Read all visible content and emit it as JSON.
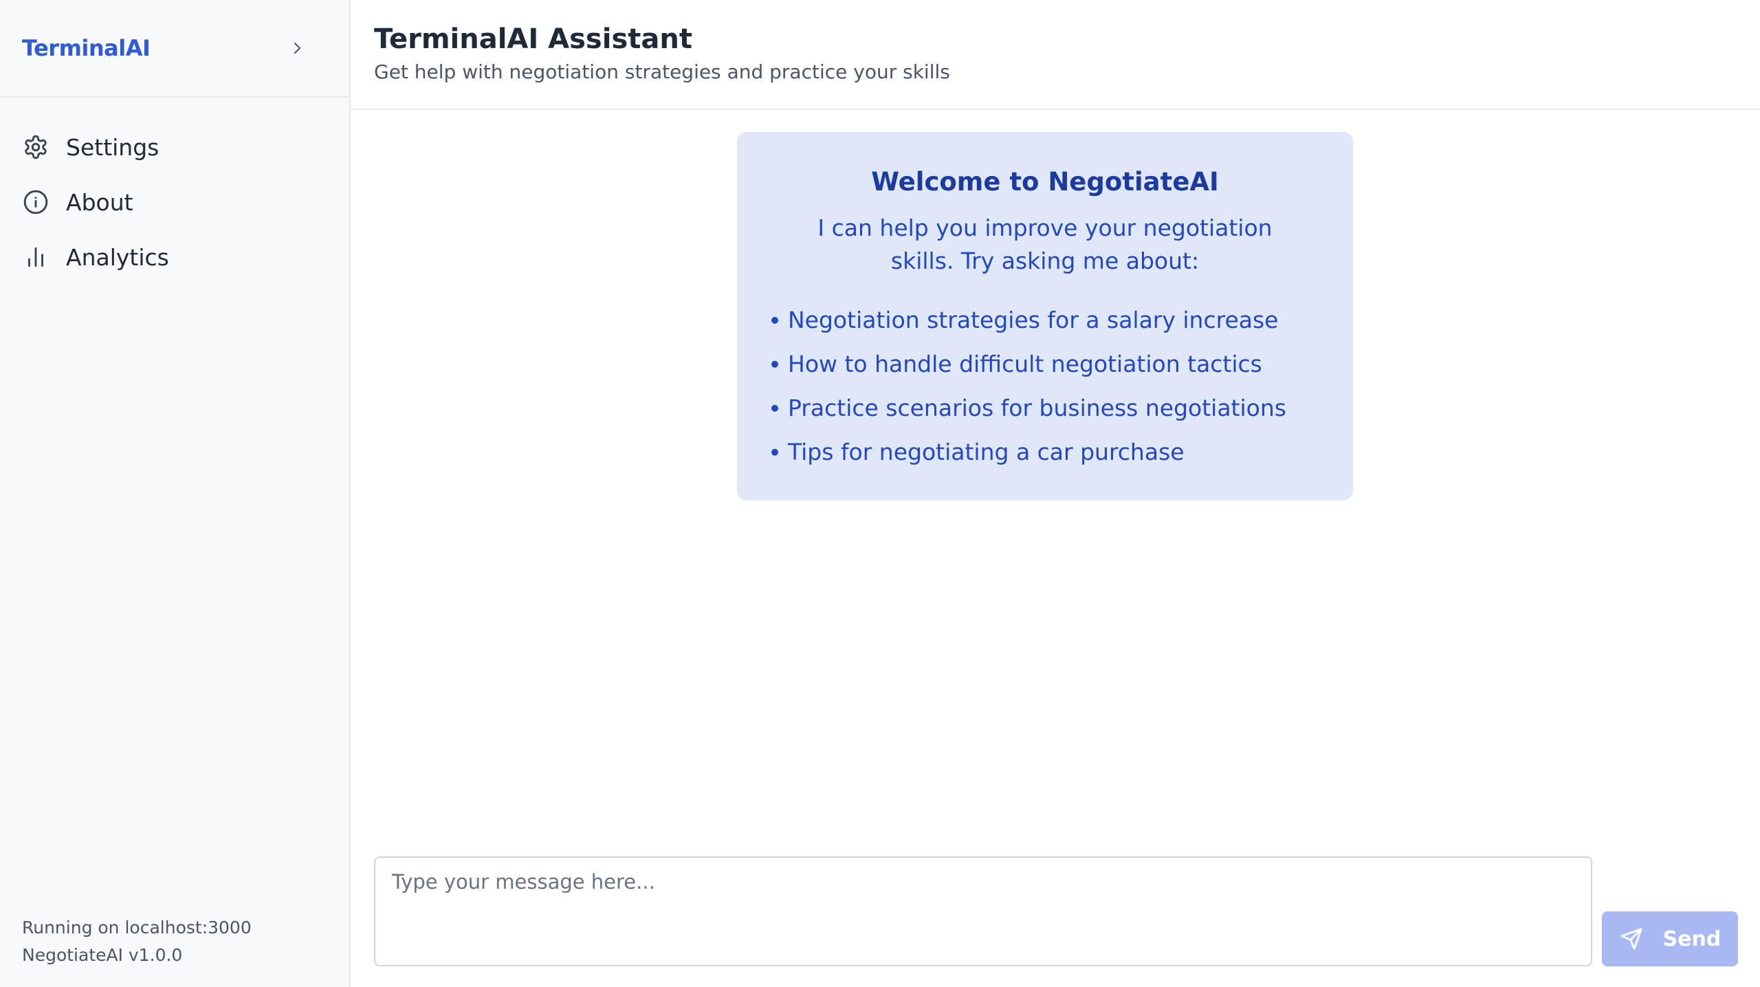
{
  "sidebar": {
    "brand": "TerminalAI",
    "collapse_icon": "chevron-right-icon",
    "items": [
      {
        "label": "Settings",
        "icon": "gear-icon"
      },
      {
        "label": "About",
        "icon": "info-icon"
      },
      {
        "label": "Analytics",
        "icon": "bar-chart-icon"
      }
    ],
    "footer": {
      "status": "Running on localhost:3000",
      "version": "NegotiateAI v1.0.0"
    }
  },
  "header": {
    "title": "TerminalAI Assistant",
    "subtitle": "Get help with negotiation strategies and practice your skills"
  },
  "welcome": {
    "title": "Welcome to NegotiateAI",
    "intro": "I can help you improve your negotiation skills. Try asking me about:",
    "suggestions": [
      "Negotiation strategies for a salary increase",
      "How to handle difficult negotiation tactics",
      "Practice scenarios for business negotiations",
      "Tips for negotiating a car purchase"
    ]
  },
  "composer": {
    "placeholder": "Type your message here...",
    "value": "",
    "send_label": "Send",
    "send_icon": "send-icon"
  },
  "colors": {
    "brand": "#2f5bd8",
    "card_bg": "#dfe8f8",
    "card_text": "#2446c0",
    "send_button": "#a7b8f3",
    "sidebar_bg": "#f8f9fb"
  }
}
